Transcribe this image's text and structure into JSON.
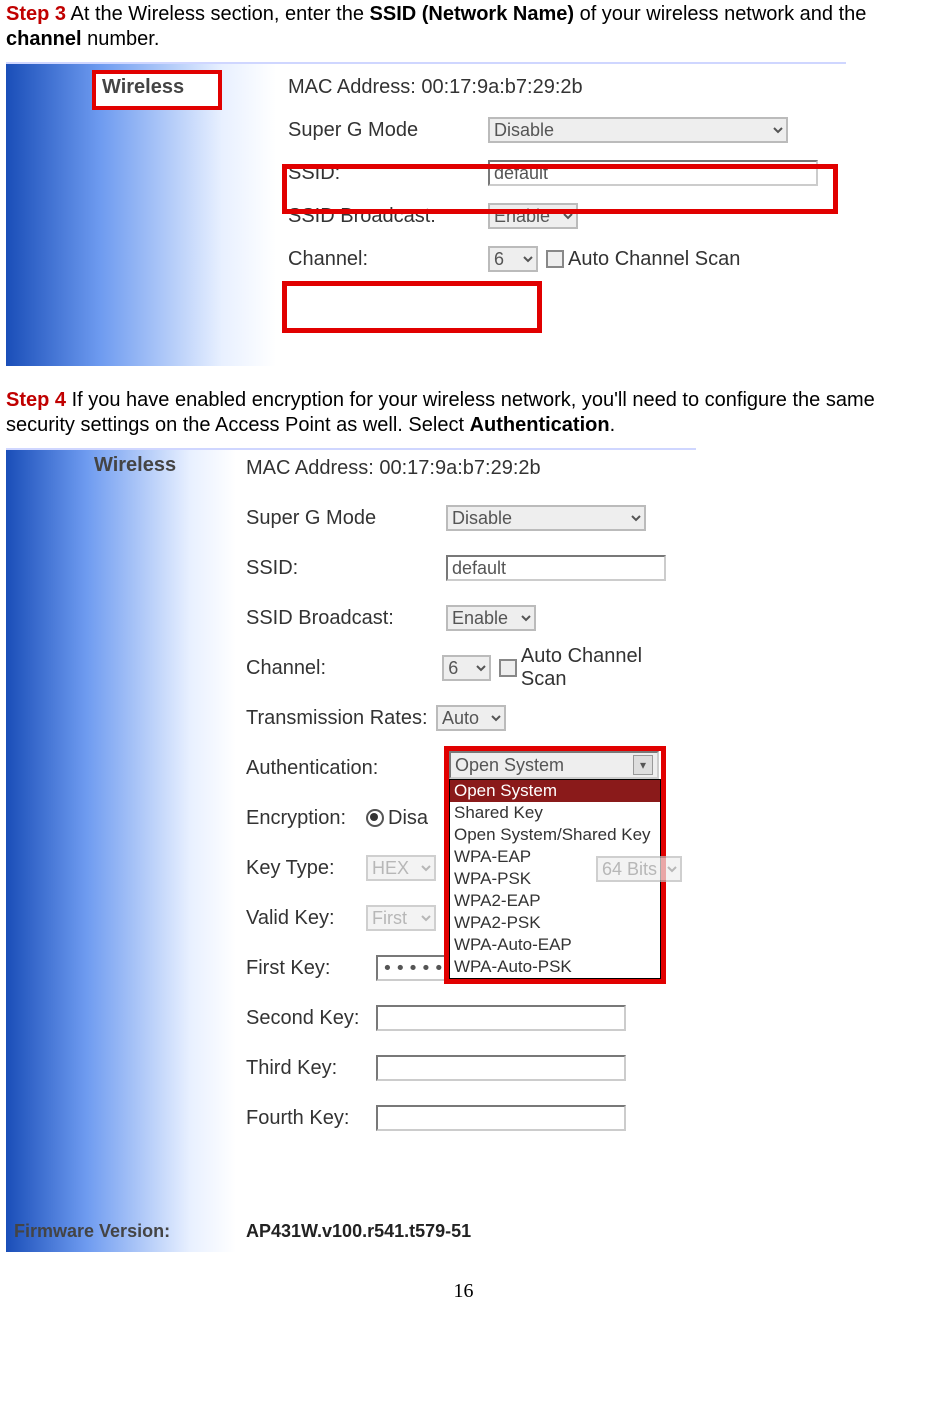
{
  "step3": {
    "label": "Step 3",
    "text_a": " At the Wireless section, enter the ",
    "bold_a": "SSID (Network Name)",
    "text_b": " of your wireless network and the ",
    "bold_b": "channel",
    "text_c": " number."
  },
  "fig1": {
    "section_title": "Wireless",
    "mac_label": "MAC Address: 00:17:9a:b7:29:2b",
    "superg_label": "Super G Mode",
    "superg_value": "Disable",
    "ssid_label": "SSID:",
    "ssid_value": "default",
    "broadcast_label": "SSID Broadcast:",
    "broadcast_value": "Enable",
    "channel_label": "Channel:",
    "channel_value": "6",
    "auto_scan_label": "Auto Channel Scan"
  },
  "step4": {
    "label": "Step 4",
    "text_a": " If you have enabled encryption for your wireless network, you'll need to configure the same security settings on the Access Point as well. Select ",
    "bold_a": "Authentication",
    "text_b": "."
  },
  "fig2": {
    "section_title": "Wireless",
    "mac_label": "MAC Address: 00:17:9a:b7:29:2b",
    "superg_label": "Super G Mode",
    "superg_value": "Disable",
    "ssid_label": "SSID:",
    "ssid_value": "default",
    "broadcast_label": "SSID Broadcast:",
    "broadcast_value": "Enable",
    "channel_label": "Channel:",
    "channel_value": "6",
    "auto_scan_label": "Auto Channel Scan",
    "tx_label": "Transmission Rates:",
    "tx_value": "Auto",
    "auth_label": "Authentication:",
    "auth_selected": "Open System",
    "auth_options": [
      "Open System",
      "Shared Key",
      "Open System/Shared Key",
      "WPA-EAP",
      "WPA-PSK",
      "WPA2-EAP",
      "WPA2-PSK",
      "WPA-Auto-EAP",
      "WPA-Auto-PSK"
    ],
    "enc_label": "Encryption:",
    "enc_value": "Disa",
    "keytype_label": "Key Type:",
    "keytype_value": "HEX",
    "keysize_value": "64 Bits",
    "validkey_label": "Valid Key:",
    "validkey_value": "First",
    "k1_label": "First Key:",
    "k1_dots": "••••••••••",
    "k2_label": "Second Key:",
    "k3_label": "Third Key:",
    "k4_label": "Fourth Key:",
    "fw_label": "Firmware Version:",
    "fw_value": "AP431W.v100.r541.t579-51"
  },
  "page_number": "16"
}
